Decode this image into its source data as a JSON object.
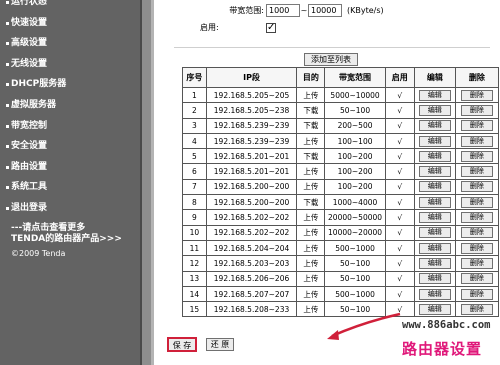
{
  "sidebar": {
    "items": [
      {
        "label": "运行状态"
      },
      {
        "label": "快速设置"
      },
      {
        "label": "高级设置"
      },
      {
        "label": "无线设置"
      },
      {
        "label": "DHCP服务器"
      },
      {
        "label": "虚拟服务器"
      },
      {
        "label": "带宽控制"
      },
      {
        "label": "安全设置"
      },
      {
        "label": "路由设置"
      },
      {
        "label": "系统工具"
      },
      {
        "label": "退出登录"
      }
    ],
    "more_line1": "---请点击查看更多",
    "more_line2": "TENDA的路由器产品>>>",
    "copyright": "©2009 Tenda"
  },
  "form": {
    "bandwidth_label": "带宽范围:",
    "bandwidth_min": "1000",
    "bandwidth_sep": "~",
    "bandwidth_max": "10000",
    "bandwidth_unit": "(KByte/s)",
    "enable_label": "启用:",
    "enable_checked": true,
    "add_button": "添加至列表"
  },
  "table": {
    "headers": [
      "序号",
      "IP段",
      "目的",
      "带宽范围",
      "启用",
      "编辑",
      "删除"
    ],
    "edit_label": "编辑",
    "delete_label": "删除",
    "rows": [
      {
        "no": "1",
        "ip": "192.168.5.205~205",
        "dir": "上传",
        "bw": "5000~10000",
        "enabled": "√"
      },
      {
        "no": "2",
        "ip": "192.168.5.205~238",
        "dir": "下载",
        "bw": "50~100",
        "enabled": "√"
      },
      {
        "no": "3",
        "ip": "192.168.5.239~239",
        "dir": "下载",
        "bw": "200~500",
        "enabled": "√"
      },
      {
        "no": "4",
        "ip": "192.168.5.239~239",
        "dir": "上传",
        "bw": "100~100",
        "enabled": "√"
      },
      {
        "no": "5",
        "ip": "192.168.5.201~201",
        "dir": "下载",
        "bw": "100~200",
        "enabled": "√"
      },
      {
        "no": "6",
        "ip": "192.168.5.201~201",
        "dir": "上传",
        "bw": "100~200",
        "enabled": "√"
      },
      {
        "no": "7",
        "ip": "192.168.5.200~200",
        "dir": "上传",
        "bw": "100~200",
        "enabled": "√"
      },
      {
        "no": "8",
        "ip": "192.168.5.200~200",
        "dir": "下载",
        "bw": "1000~4000",
        "enabled": "√"
      },
      {
        "no": "9",
        "ip": "192.168.5.202~202",
        "dir": "上传",
        "bw": "20000~50000",
        "enabled": "√"
      },
      {
        "no": "10",
        "ip": "192.168.5.202~202",
        "dir": "上传",
        "bw": "10000~20000",
        "enabled": "√"
      },
      {
        "no": "11",
        "ip": "192.168.5.204~204",
        "dir": "上传",
        "bw": "500~1000",
        "enabled": "√"
      },
      {
        "no": "12",
        "ip": "192.168.5.203~203",
        "dir": "上传",
        "bw": "50~100",
        "enabled": "√"
      },
      {
        "no": "13",
        "ip": "192.168.5.206~206",
        "dir": "上传",
        "bw": "50~100",
        "enabled": "√"
      },
      {
        "no": "14",
        "ip": "192.168.5.207~207",
        "dir": "上传",
        "bw": "500~1000",
        "enabled": "√"
      },
      {
        "no": "15",
        "ip": "192.168.5.208~233",
        "dir": "上传",
        "bw": "50~100",
        "enabled": "√"
      }
    ]
  },
  "footer": {
    "save_label": "保 存",
    "reset_label": "还 原"
  },
  "watermark": {
    "url": "www.886abc.com",
    "brand": "路由器设置"
  },
  "colors": {
    "sidebar_bg": "#636363",
    "highlight_red": "#d0203a",
    "brand_pink": "#e0187a"
  }
}
